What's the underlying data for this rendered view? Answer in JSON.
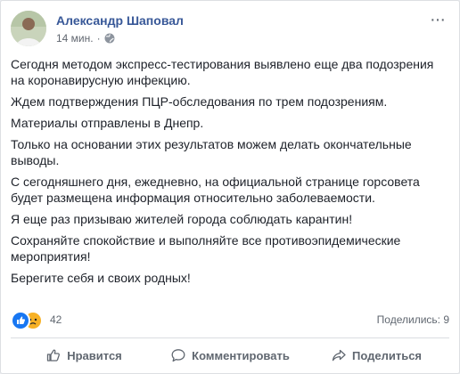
{
  "post": {
    "author": "Александр Шаповал",
    "time": "14 мин.",
    "paragraphs": [
      "Сегодня методом экспресс-тестирования выявлено еще два подозрения на коронавирусную инфекцию.",
      "Ждем подтверждения ПЦР-обследования по трем подозрениям.",
      "Материалы отправлены в Днепр.",
      "Только на основании этих результатов можем делать окончательные выводы.",
      "С сегодняшнего дня, ежедневно, на официальной странице горсовета будет размещена информация относительно заболеваемости.",
      "Я еще раз призываю жителей города соблюдать карантин!",
      "Сохраняйте спокойствие и выполняйте все противоэпидемические мероприятия!",
      "Берегите себя и своих родных!"
    ],
    "reactions_count": "42",
    "shares": "Поделились: 9"
  },
  "actions": {
    "like": "Нравится",
    "comment": "Комментировать",
    "share": "Поделиться"
  },
  "colors": {
    "name": "#385898",
    "like": "#1877f2",
    "sad": "#f7b125",
    "text": "#1d2129",
    "muted": "#606770"
  },
  "icons": [
    "avatar",
    "globe-icon",
    "more-icon",
    "like-reaction-icon",
    "sad-reaction-icon",
    "like-icon",
    "comment-icon",
    "share-icon"
  ]
}
